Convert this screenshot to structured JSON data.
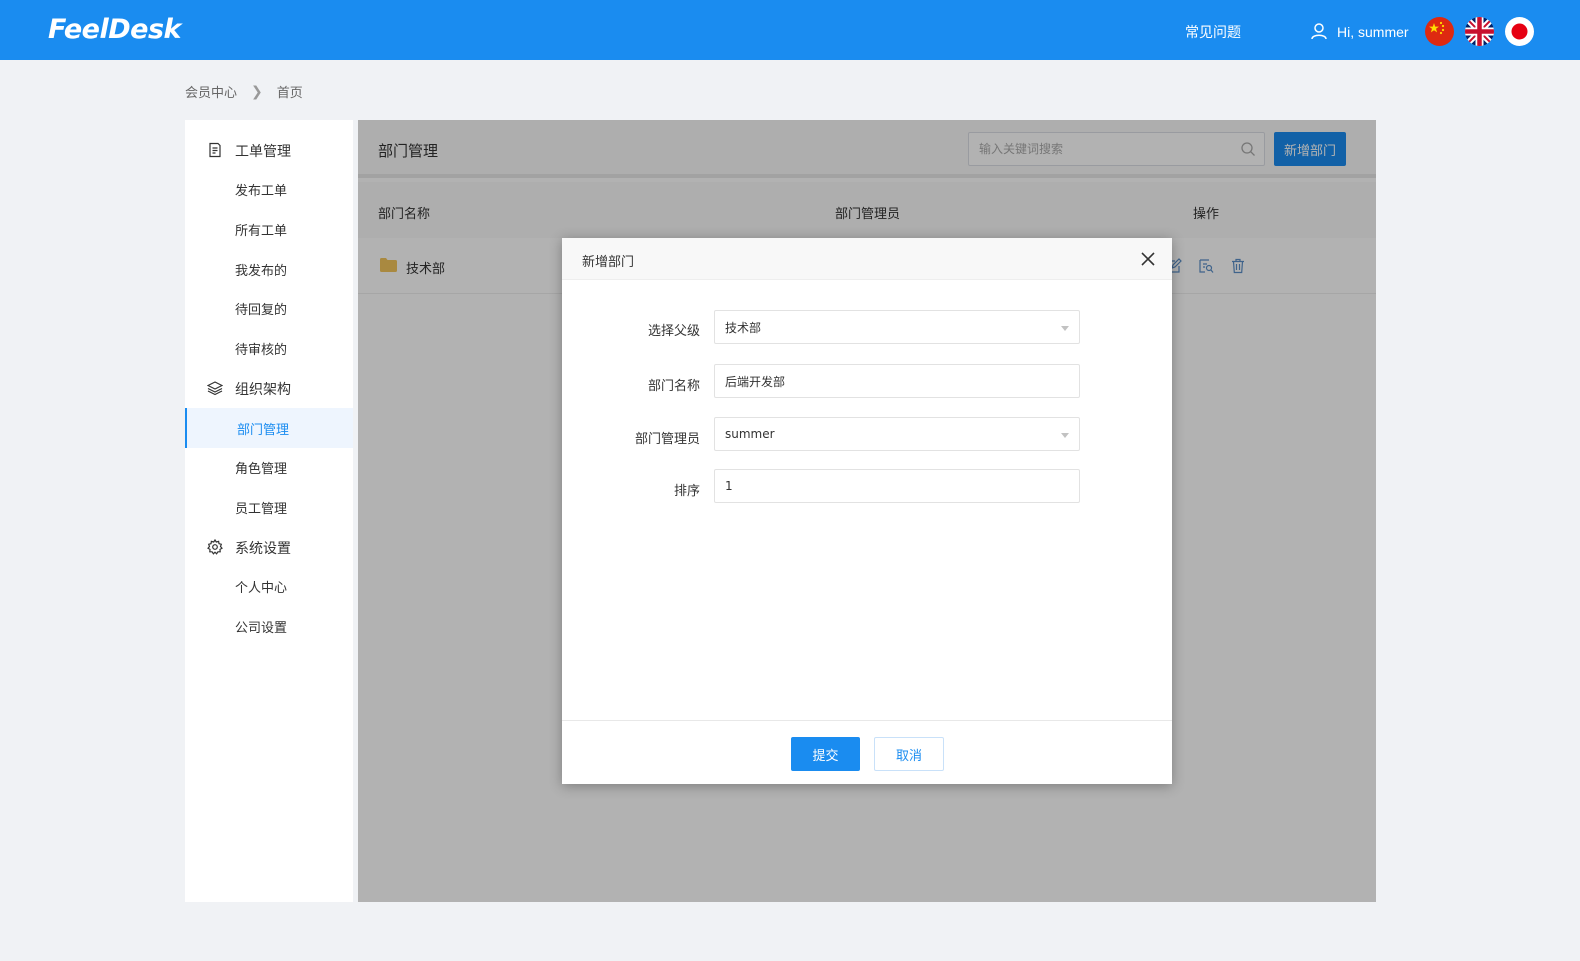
{
  "header": {
    "logo": "FeelDesk",
    "faq_label": "常见问题",
    "greeting": "Hi,  summer",
    "languages": [
      "zh-CN",
      "en-GB",
      "ja-JP"
    ]
  },
  "breadcrumb": {
    "items": [
      "会员中心",
      "首页"
    ]
  },
  "sidebar": {
    "groups": [
      {
        "label": "工单管理",
        "icon": "document-icon",
        "items": [
          "发布工单",
          "所有工单",
          "我发布的",
          "待回复的",
          "待审核的"
        ]
      },
      {
        "label": "组织架构",
        "icon": "layers-icon",
        "items": [
          "部门管理",
          "角色管理",
          "员工管理"
        ]
      },
      {
        "label": "系统设置",
        "icon": "gear-icon",
        "items": [
          "个人中心",
          "公司设置"
        ]
      }
    ],
    "active_item": "部门管理"
  },
  "main": {
    "title": "部门管理",
    "search_placeholder": "输入关键词搜索",
    "add_button": "新增部门",
    "table": {
      "columns": [
        "部门名称",
        "部门管理员",
        "操作"
      ],
      "rows": [
        {
          "name": "技术部",
          "manager": ""
        }
      ]
    }
  },
  "modal": {
    "title": "新增部门",
    "fields": [
      {
        "label": "选择父级",
        "value": "技术部",
        "type": "select"
      },
      {
        "label": "部门名称",
        "value": "后端开发部",
        "type": "text"
      },
      {
        "label": "部门管理员",
        "value": "summer",
        "type": "select"
      },
      {
        "label": "排序",
        "value": "1",
        "type": "text"
      }
    ],
    "submit_label": "提交",
    "cancel_label": "取消"
  },
  "colors": {
    "primary": "#1a8cf0",
    "overlay": "rgba(0,0,0,0.3)"
  }
}
